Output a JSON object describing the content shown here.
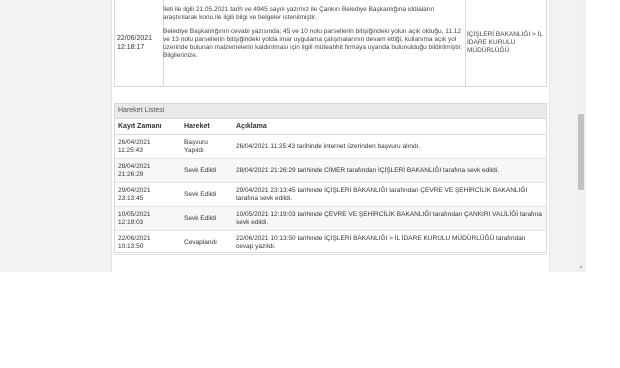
{
  "detail": {
    "date": "22/06/2021\n12:18:17",
    "paragraph1": "İleti ile ilgili 21.05.2021 tarih ve 4945 sayılı yazımız ile Çankırı Belediye Başkanlığına iddiaların araştırılarak konu ile ilgili bilgi ve belgeler istenilmiştir.",
    "paragraph2": "Belediye Başkanlığının cevabi yazısında; 45 ve 10 nolu parsellerin bitişiğindeki yolun açık olduğu, 11,12 ve 13 nolu parsellerin bitişiğindeki yolda imar uygulama çalışmalarının devam ettiği, kullanıma açık yol üzerinde bulunan malzemelerin kaldırılması için ilgili müteahhit firmaya uyarıda bulunulduğu bildirilmiştir. Bilgilerinize.",
    "unit": "İÇİŞLERİ BAKANLIĞI > İL İDARE KURULU MÜDÜRLÜĞÜ"
  },
  "hareket": {
    "title": "Hareket Listesi",
    "headers": [
      "Kayıt Zamanı",
      "Hareket",
      "Açıklama"
    ],
    "rows": [
      {
        "time": "26/04/2021\n11:25:43",
        "action": "Başvuru\nYapıldı",
        "desc": "26/04/2021 11:25:43 tarihinde internet üzerinden başvuru alındı."
      },
      {
        "time": "28/04/2021\n21:26:29",
        "action": "Sevk Edildi",
        "desc": "28/04/2021 21:26:29 tarihinde CİMER tarafından İÇİŞLERİ BAKANLIĞI tarafına sevk edildi."
      },
      {
        "time": "29/04/2021\n23:13:45",
        "action": "Sevk Edildi",
        "desc": "29/04/2021 23:13:45 tarihinde İÇİŞLERİ BAKANLIĞI tarafından ÇEVRE VE ŞEHİRCİLİK BAKANLIĞI tarafına sevk edildi."
      },
      {
        "time": "10/05/2021\n12:19:03",
        "action": "Sevk Edildi",
        "desc": "10/05/2021 12:19:03 tarihinde ÇEVRE VE ŞEHİRCİLİK BAKANLIĞI tarafından ÇANKIRI VALİLİĞİ tarafına sevk edildi."
      },
      {
        "time": "22/06/2021\n10:13:50",
        "action": "Cevaplandı",
        "desc": "22/06/2021 10:13:50 tarihinde İÇİŞLERİ BAKANLIĞI > İL İDARE KURULU MÜDÜRLÜĞÜ tarafından cevap yazıldı."
      }
    ]
  },
  "scrollbar": {
    "down_arrow": "⌄"
  }
}
